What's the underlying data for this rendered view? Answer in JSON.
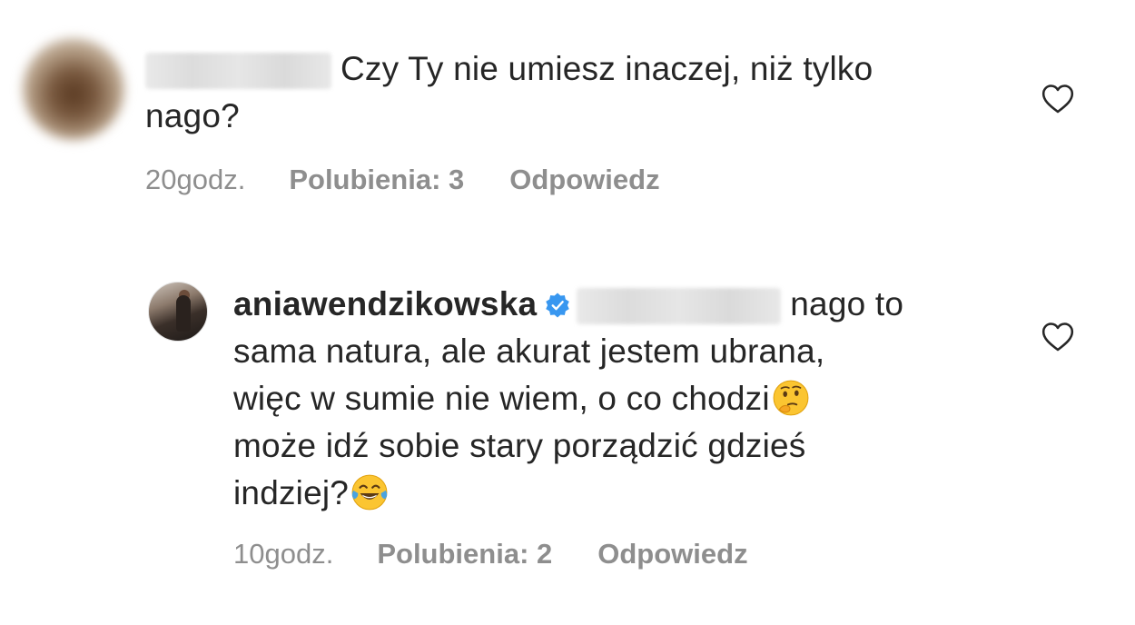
{
  "comments": [
    {
      "username_hidden": true,
      "text_line1": "Czy Ty nie umiesz inaczej, niż tylko",
      "text_line2": "nago?",
      "time": "20godz.",
      "likes": "Polubienia: 3",
      "reply": "Odpowiedz"
    },
    {
      "username": "aniawendzikowska",
      "verified": true,
      "mention_hidden": true,
      "text_part1": "nago to",
      "text_line2": "sama natura, ale akurat jestem ubrana,",
      "text_line3": "więc w sumie nie wiem, o co chodzi",
      "text_line4": "może idź sobie stary porządzić gdzieś",
      "text_line5": "indziej?",
      "emoji_1": "thinking-face-emoji",
      "emoji_2": "tears-of-joy-emoji",
      "time": "10godz.",
      "likes": "Polubienia: 2",
      "reply": "Odpowiedz"
    }
  ],
  "colors": {
    "text": "#262626",
    "meta": "#8e8e8e",
    "verified_badge": "#3897f0"
  }
}
